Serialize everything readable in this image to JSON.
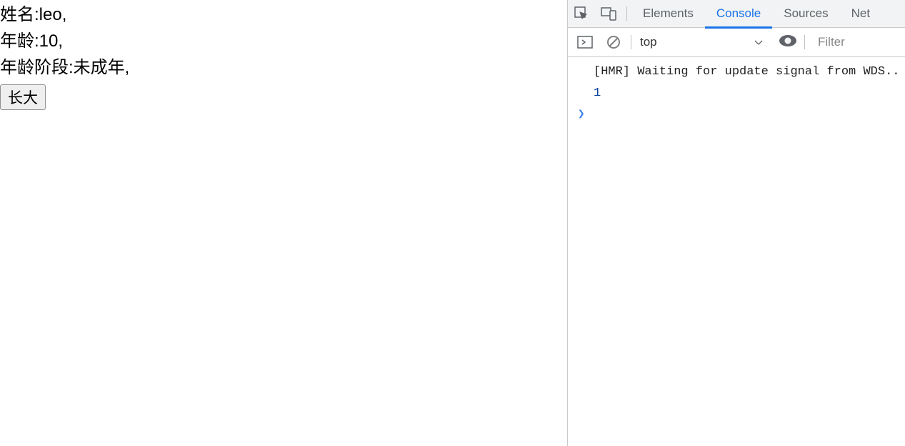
{
  "page": {
    "name_label": "姓名:",
    "name_value": "leo,",
    "age_label": "年龄:",
    "age_value": "10,",
    "stage_label": "年龄阶段:",
    "stage_value": "未成年,",
    "button_label": "长大"
  },
  "devtools": {
    "tabs": {
      "elements": "Elements",
      "console": "Console",
      "sources": "Sources",
      "network": "Net"
    },
    "toolbar": {
      "context": "top",
      "filter_placeholder": "Filter"
    },
    "console": {
      "line1": "[HMR] Waiting for update signal from WDS..",
      "line2": "1"
    }
  }
}
